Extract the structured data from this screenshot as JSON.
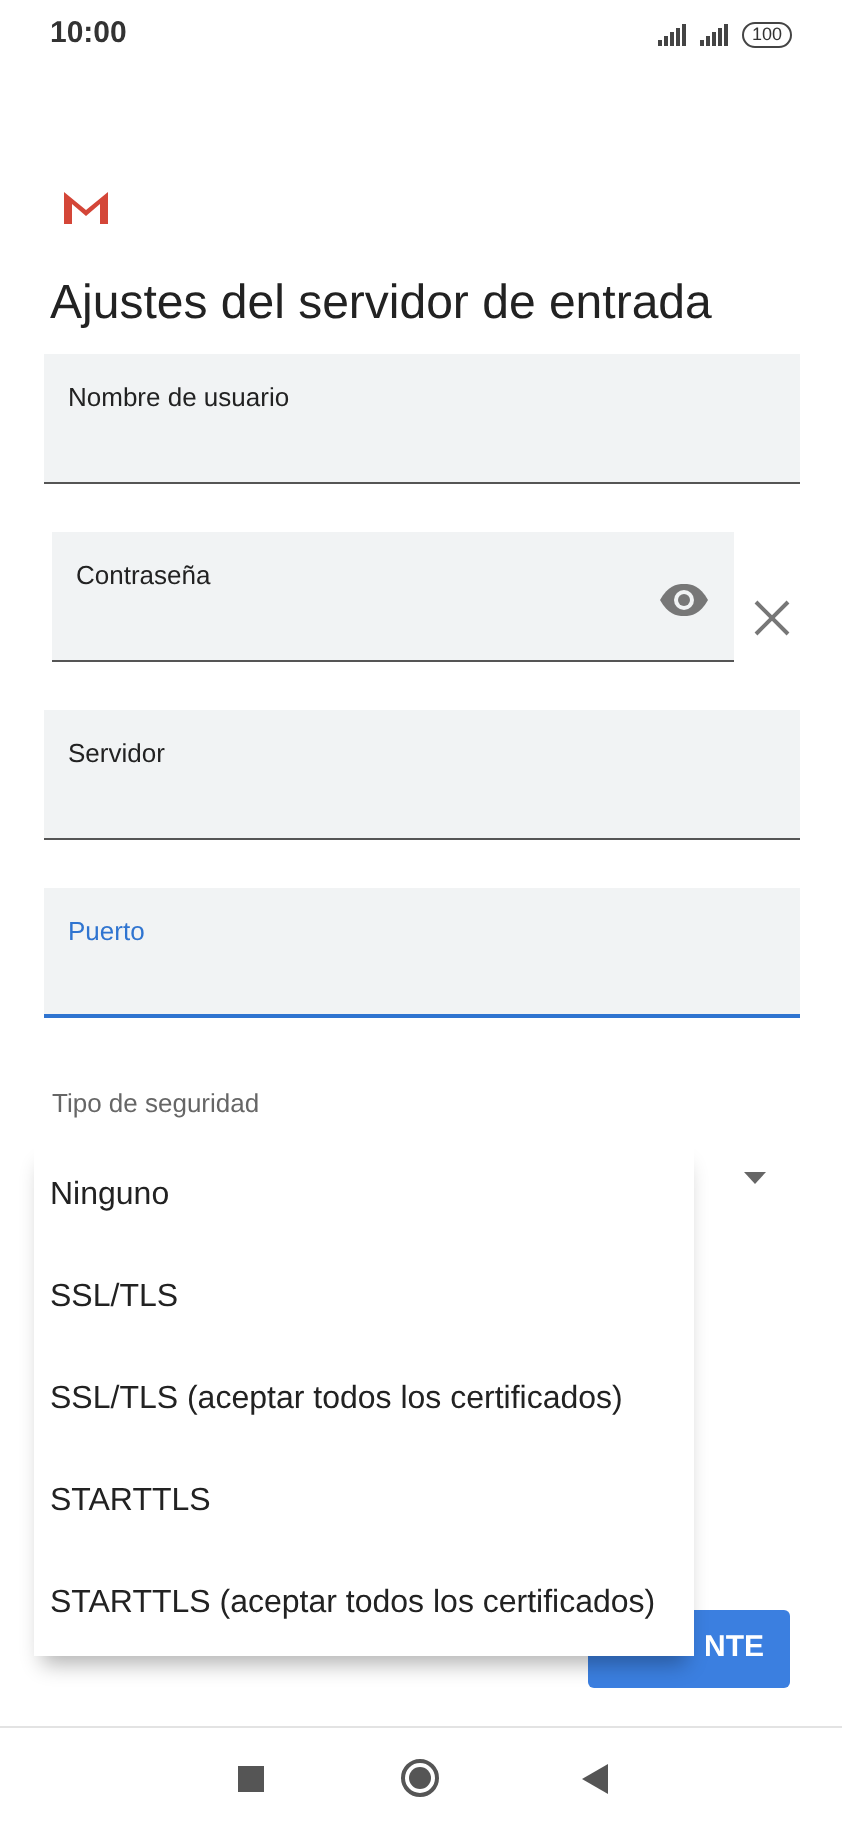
{
  "status_bar": {
    "time": "10:00",
    "battery": "100"
  },
  "title": "Ajustes del servidor de entrada",
  "fields": [
    {
      "label": "Nombre de usuario",
      "focused": false,
      "kind": "text"
    },
    {
      "label": "Contraseña",
      "focused": false,
      "kind": "password"
    },
    {
      "label": "Servidor",
      "focused": false,
      "kind": "text"
    },
    {
      "label": "Puerto",
      "focused": true,
      "kind": "text"
    }
  ],
  "security": {
    "label": "Tipo de seguridad"
  },
  "menu": {
    "items": [
      "Ninguno",
      "SSL/TLS",
      "SSL/TLS (aceptar todos los certificados)",
      "STARTTLS",
      "STARTTLS (aceptar todos los certificados)"
    ]
  },
  "next_button": "NTE"
}
